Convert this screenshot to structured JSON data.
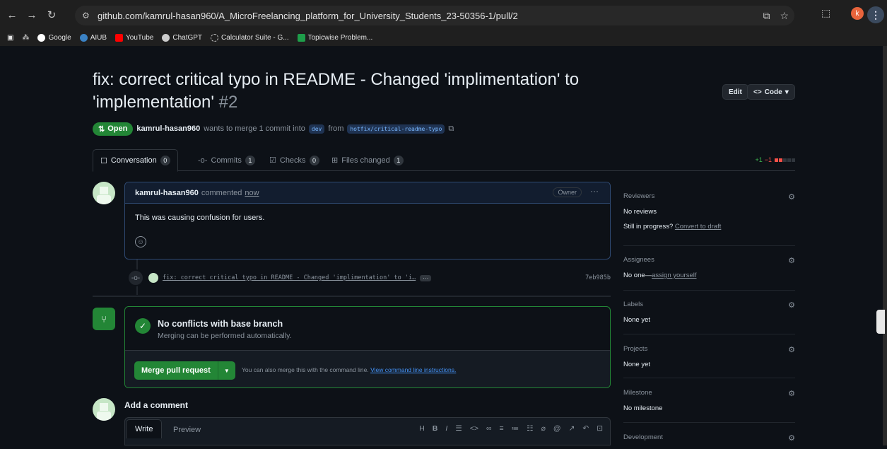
{
  "browser": {
    "url": "github.com/kamrul-hasan960/A_MicroFreelancing_platform_for_University_Students_23-50356-1/pull/2",
    "profile_initial": "k",
    "bookmarks": [
      "Google",
      "AIUB",
      "YouTube",
      "ChatGPT",
      "Calculator Suite - G...",
      "Topicwise Problem..."
    ]
  },
  "pr": {
    "title": "fix: correct critical typo in README - Changed 'implimentation' to 'implementation'",
    "number": "#2",
    "edit_label": "Edit",
    "code_label": "Code",
    "state": "Open",
    "author": "kamrul-hasan960",
    "merge_text": "wants to merge 1 commit into",
    "base": "dev",
    "from_text": "from",
    "head": "hotfix/critical-readme-typo"
  },
  "tabs": [
    {
      "label": "Conversation",
      "count": "0"
    },
    {
      "label": "Commits",
      "count": "1"
    },
    {
      "label": "Checks",
      "count": "0"
    },
    {
      "label": "Files changed",
      "count": "1"
    }
  ],
  "diffstat": {
    "added": "+1",
    "removed": "−1"
  },
  "comment": {
    "author": "kamrul-hasan960",
    "action": "commented",
    "time": "now",
    "role": "Owner",
    "body": "This was causing confusion for users."
  },
  "commit": {
    "message": "fix: correct critical typo in README - Changed 'implimentation' to 'i…",
    "sha": "7eb985b"
  },
  "merge": {
    "title": "No conflicts with base branch",
    "subtitle": "Merging can be performed automatically.",
    "button": "Merge pull request",
    "hint": "You can also merge this with the command line.",
    "hint_link": "View command line instructions."
  },
  "add_comment": {
    "title": "Add a comment",
    "write": "Write",
    "preview": "Preview"
  },
  "sidebar": {
    "reviewers": {
      "heading": "Reviewers",
      "value": "No reviews",
      "progress": "Still in progress?",
      "draft_link": "Convert to draft"
    },
    "assignees": {
      "heading": "Assignees",
      "value": "No one—",
      "link": "assign yourself"
    },
    "labels": {
      "heading": "Labels",
      "value": "None yet"
    },
    "projects": {
      "heading": "Projects",
      "value": "None yet"
    },
    "milestone": {
      "heading": "Milestone",
      "value": "No milestone"
    },
    "development": {
      "heading": "Development"
    }
  },
  "colors": {
    "open_green": "#238636",
    "link_blue": "#4493f8",
    "bg": "#0d1117"
  }
}
